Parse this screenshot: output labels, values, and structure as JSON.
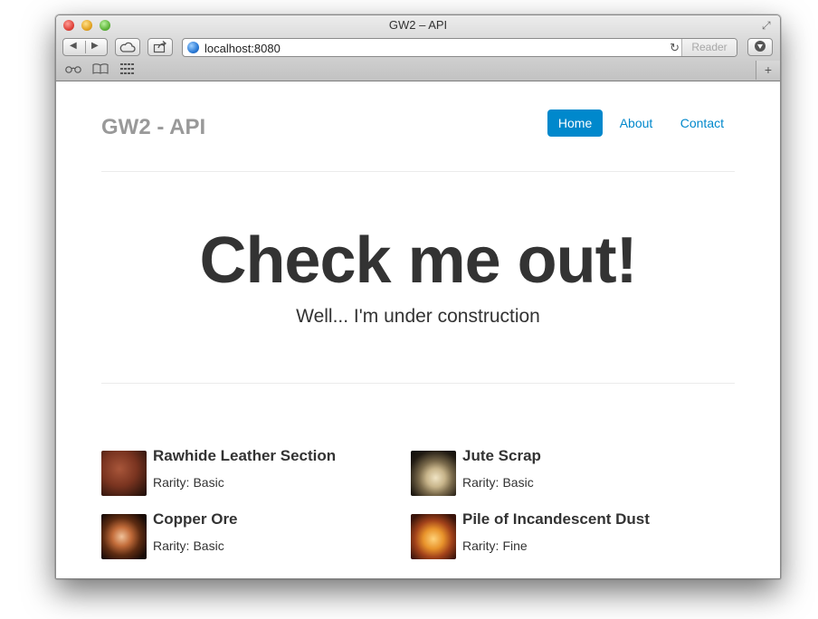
{
  "window": {
    "title": "GW2 – API"
  },
  "toolbar": {
    "url": "localhost:8080",
    "reader_label": "Reader",
    "back_arrow": "◀",
    "forward_arrow": "▶",
    "new_tab_symbol": "+"
  },
  "site": {
    "brand": "GW2 - API",
    "nav": [
      {
        "label": "Home",
        "active": true
      },
      {
        "label": "About",
        "active": false
      },
      {
        "label": "Contact",
        "active": false
      }
    ]
  },
  "hero": {
    "title": "Check me out!",
    "subtitle": "Well... I'm under construction"
  },
  "items": [
    {
      "name": "Rawhide Leather Section",
      "rarity_label": "Rarity:",
      "rarity": "Basic",
      "icon": "leather-icon"
    },
    {
      "name": "Jute Scrap",
      "rarity_label": "Rarity:",
      "rarity": "Basic",
      "icon": "jute-icon"
    },
    {
      "name": "Copper Ore",
      "rarity_label": "Rarity:",
      "rarity": "Basic",
      "icon": "copper-ore-icon"
    },
    {
      "name": "Pile of Incandescent Dust",
      "rarity_label": "Rarity:",
      "rarity": "Fine",
      "icon": "dust-icon"
    }
  ],
  "colors": {
    "link": "#0088cc",
    "brand_text": "#999999",
    "body_text": "#333333"
  }
}
